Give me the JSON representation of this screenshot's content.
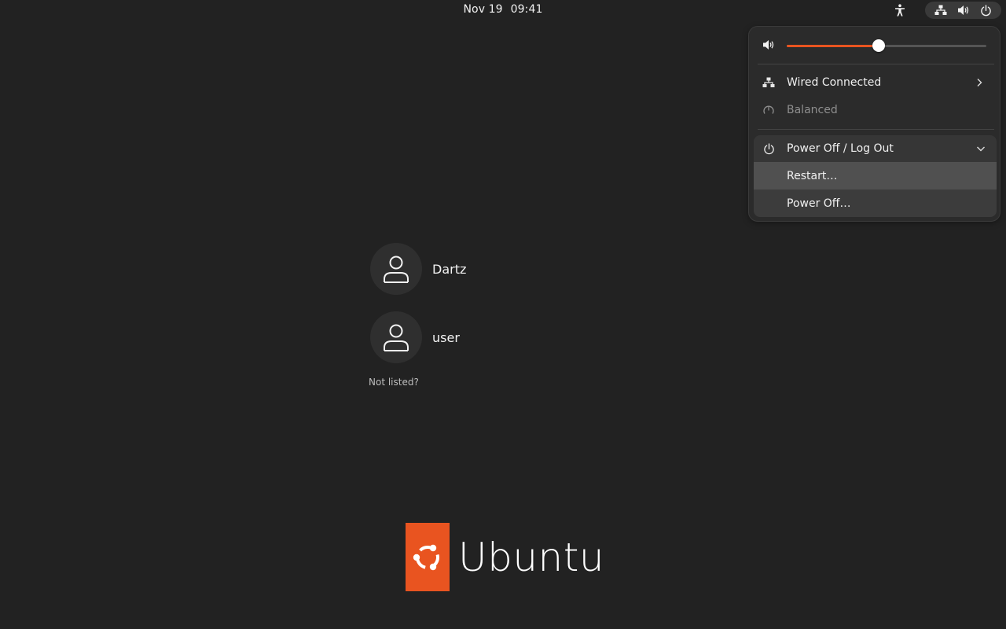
{
  "topbar": {
    "date": "Nov 19",
    "time": "09:41",
    "icons": [
      "accessibility-icon",
      "network-wired-icon",
      "volume-icon",
      "power-icon"
    ]
  },
  "quick_settings": {
    "volume": {
      "level_fraction": 0.46,
      "icon": "volume-icon"
    },
    "network": {
      "label": "Wired Connected",
      "icon": "network-wired-icon"
    },
    "power_mode": {
      "label": "Balanced",
      "icon": "power-profile-icon"
    },
    "power_menu": {
      "label": "Power Off / Log Out",
      "icon": "power-icon",
      "items": [
        {
          "label": "Restart…"
        },
        {
          "label": "Power Off…"
        }
      ]
    }
  },
  "login": {
    "users": [
      {
        "name": "Dartz"
      },
      {
        "name": "user"
      }
    ],
    "not_listed": "Not listed?"
  },
  "branding": {
    "logo_text": "Ubuntu",
    "accent_color": "#e95420"
  }
}
